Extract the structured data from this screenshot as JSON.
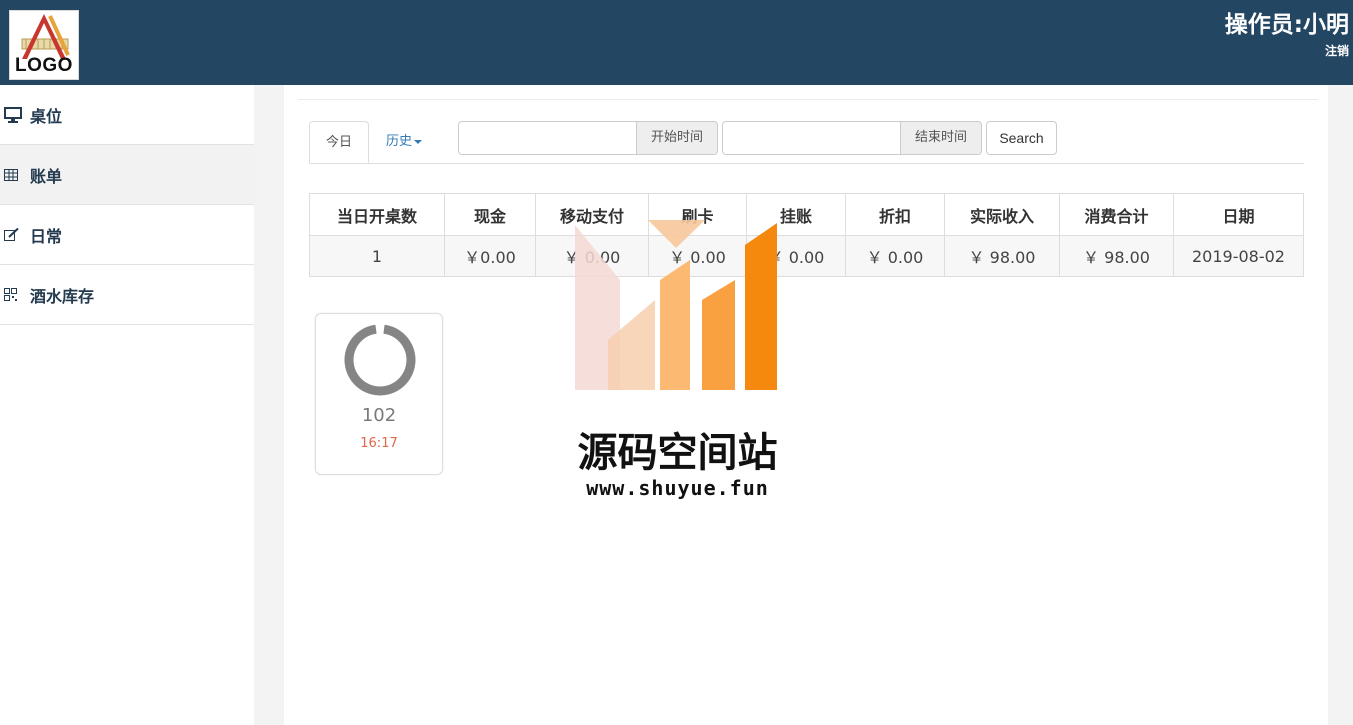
{
  "header": {
    "logo_text": "LOGO",
    "operator": "操作员:小明",
    "logout": "注销"
  },
  "sidebar": {
    "items": [
      {
        "label": "桌位",
        "icon": "monitor-icon"
      },
      {
        "label": "账单",
        "icon": "table-icon"
      },
      {
        "label": "日常",
        "icon": "edit-icon"
      },
      {
        "label": "酒水库存",
        "icon": "qrcode-icon"
      }
    ]
  },
  "tabs": {
    "today": "今日",
    "history": "历史"
  },
  "filters": {
    "start_addon": "开始时间",
    "end_addon": "结束时间",
    "start_value": "",
    "end_value": "",
    "search_button": "Search"
  },
  "summary": {
    "headers": [
      "当日开桌数",
      "现金",
      "移动支付",
      "刷卡",
      "挂账",
      "折扣",
      "实际收入",
      "消费合计",
      "日期"
    ],
    "row": [
      "1",
      "￥0.00",
      "￥ 0.00",
      "￥ 0.00",
      "￥ 0.00",
      "￥ 0.00",
      "￥ 98.00",
      "￥ 98.00",
      "2019-08-02"
    ]
  },
  "table_card": {
    "number": "102",
    "time": "16:17"
  },
  "watermark": {
    "title": "源码空间站",
    "url": "www.shuyue.fun"
  },
  "colors": {
    "header_bg": "#234662",
    "accent_link": "#337ab7",
    "time_color": "#e0674a",
    "watermark_orange": "#f5890e"
  }
}
